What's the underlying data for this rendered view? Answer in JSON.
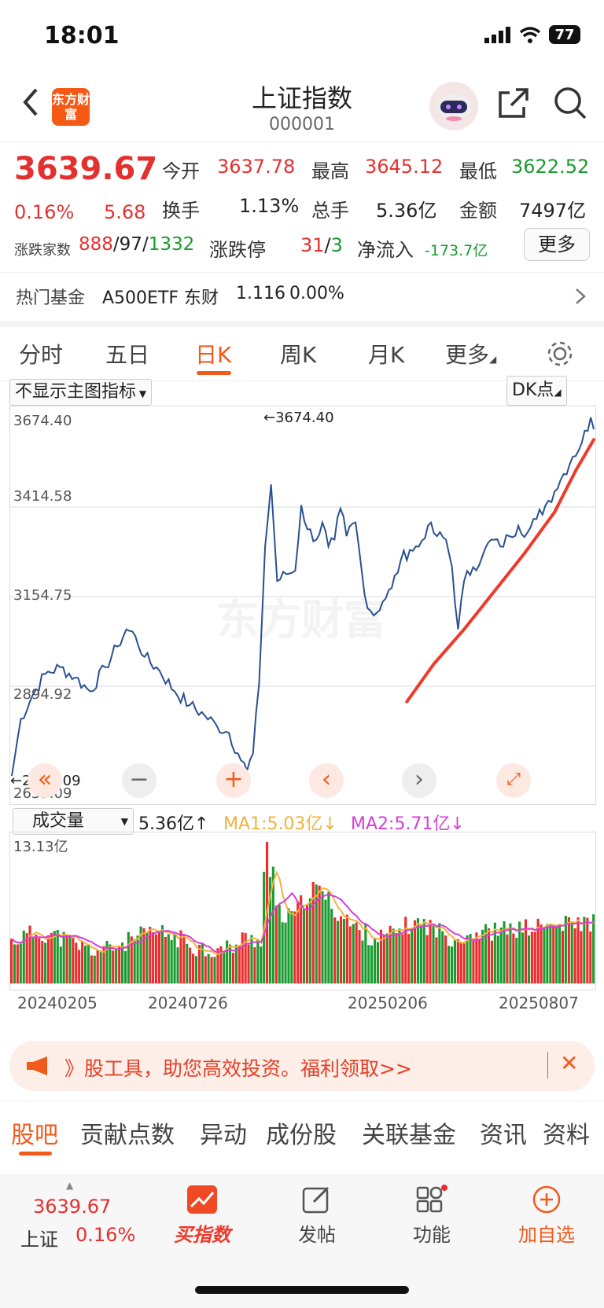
{
  "status_bar": {
    "time": "18:01",
    "battery": "77"
  },
  "header": {
    "title": "上证指数",
    "code": "000001",
    "back_icon": "chevron-left-icon",
    "logo_text": "东方财富"
  },
  "quote": {
    "price": "3639.67",
    "change_pct": "0.16%",
    "change": "5.68",
    "open_label": "今开",
    "open": "3637.78",
    "high_label": "最高",
    "high": "3645.12",
    "low_label": "最低",
    "low": "3622.52",
    "turnover_label": "换手",
    "turnover": "1.13%",
    "volume_label": "总手",
    "volume": "5.36亿",
    "amount_label": "金额",
    "amount": "7497亿",
    "breadth_label": "涨跌家数",
    "up": "888",
    "flat": "97",
    "down": "1332",
    "limit_label": "涨跌停",
    "limit_up": "31",
    "limit_down": "3",
    "netflow_label": "净流入",
    "netflow": "-173.7亿",
    "more_btn": "更多"
  },
  "fund_bar": {
    "label": "热门基金",
    "name": "A500ETF 东财",
    "price": "1.116",
    "pct": "0.00%"
  },
  "tabs": [
    {
      "label": "分时"
    },
    {
      "label": "五日"
    },
    {
      "label": "日K"
    },
    {
      "label": "周K"
    },
    {
      "label": "月K"
    },
    {
      "label": "更多"
    }
  ],
  "chart": {
    "indicator_select": "不显示主图指标",
    "dk_button": "DK点",
    "y_ticks": [
      "3674.40",
      "3414.58",
      "3154.75",
      "2894.92",
      "2635.09"
    ],
    "max_label": "←3674.40",
    "min_label": "←2635.09",
    "watermark": "东方财富",
    "volume_select": "成交量",
    "volume_value": "5.36亿↑",
    "ma1": "MA1:5.03亿↓",
    "ma2": "MA2:5.71亿↓",
    "vol_max": "13.13亿",
    "dates": [
      "20240205",
      "20240726",
      "20250206",
      "20250807"
    ]
  },
  "chart_data": {
    "type": "line",
    "ylim": [
      2635.09,
      3674.4
    ],
    "price_keypoints": [
      [
        0,
        2635.09
      ],
      [
        3,
        2800
      ],
      [
        7,
        2870
      ],
      [
        11,
        2930
      ],
      [
        16,
        2950
      ],
      [
        21,
        2920
      ],
      [
        26,
        2880
      ],
      [
        31,
        2950
      ],
      [
        35,
        3010
      ],
      [
        38,
        3060
      ],
      [
        41,
        3040
      ],
      [
        44,
        2980
      ],
      [
        49,
        2940
      ],
      [
        54,
        2880
      ],
      [
        59,
        2840
      ],
      [
        64,
        2810
      ],
      [
        68,
        2780
      ],
      [
        72,
        2760
      ],
      [
        75,
        2700
      ],
      [
        78,
        2650
      ],
      [
        80,
        2700
      ],
      [
        82,
        2900
      ],
      [
        84,
        3300
      ],
      [
        86,
        3480
      ],
      [
        88,
        3200
      ],
      [
        91,
        3220
      ],
      [
        94,
        3230
      ],
      [
        96,
        3420
      ],
      [
        98,
        3350
      ],
      [
        101,
        3320
      ],
      [
        103,
        3370
      ],
      [
        105,
        3300
      ],
      [
        107,
        3320
      ],
      [
        109,
        3410
      ],
      [
        111,
        3330
      ],
      [
        114,
        3370
      ],
      [
        117,
        3160
      ],
      [
        120,
        3100
      ],
      [
        123,
        3140
      ],
      [
        126,
        3180
      ],
      [
        129,
        3260
      ],
      [
        132,
        3290
      ],
      [
        135,
        3300
      ],
      [
        138,
        3360
      ],
      [
        141,
        3330
      ],
      [
        144,
        3320
      ],
      [
        146,
        3240
      ],
      [
        148,
        3060
      ],
      [
        150,
        3200
      ],
      [
        153,
        3240
      ],
      [
        156,
        3270
      ],
      [
        159,
        3320
      ],
      [
        162,
        3300
      ],
      [
        165,
        3330
      ],
      [
        168,
        3360
      ],
      [
        171,
        3340
      ],
      [
        174,
        3380
      ],
      [
        177,
        3420
      ],
      [
        180,
        3460
      ],
      [
        183,
        3510
      ],
      [
        186,
        3560
      ],
      [
        189,
        3600
      ],
      [
        192,
        3674.4
      ],
      [
        193,
        3640
      ]
    ],
    "ma_line": [
      [
        131,
        2850
      ],
      [
        140,
        2960
      ],
      [
        150,
        3060
      ],
      [
        160,
        3170
      ],
      [
        170,
        3280
      ],
      [
        180,
        3400
      ],
      [
        187,
        3520
      ],
      [
        193,
        3610
      ]
    ],
    "volume_ylim": [
      0,
      13.13
    ]
  },
  "chart_controls": [
    "chevron-left-double-icon",
    "minus-icon",
    "plus-icon",
    "chevron-left-icon",
    "chevron-right-icon",
    "expand-icon"
  ],
  "banner": {
    "text": "》股工具，助您高效投资。福利领取>>"
  },
  "lower_tabs": [
    "股吧",
    "贡献点数",
    "异动",
    "成份股",
    "关联基金",
    "资讯",
    "资料"
  ],
  "bottom_bar": {
    "mini_price": "3639.67",
    "mini_name": "上证",
    "mini_pct": "0.16%",
    "items": [
      "买指数",
      "发帖",
      "功能",
      "加自选"
    ]
  },
  "colors": {
    "accent": "#f25a1a",
    "up": "#e3312f",
    "down": "#1a9b2f",
    "line": "#2a5190",
    "ma": "#ef3a2a"
  }
}
